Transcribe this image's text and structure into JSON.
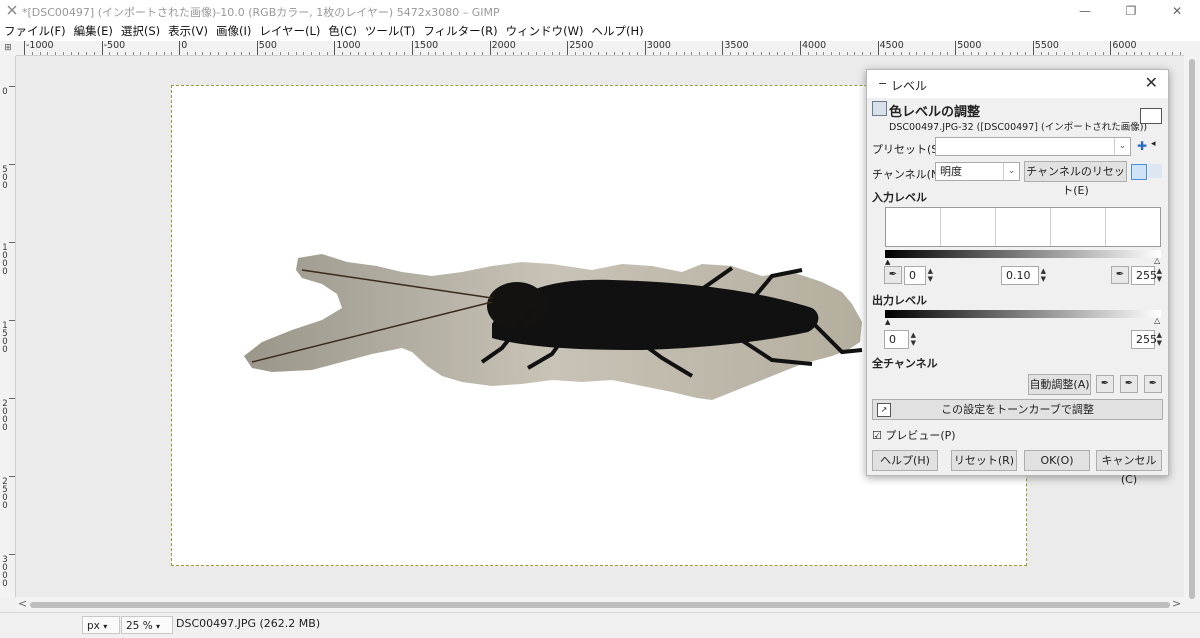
{
  "window": {
    "title": "*[DSC00497] (インポートされた画像)-10.0 (RGBカラー, 1枚のレイヤー) 5472x3080 – GIMP",
    "controls": [
      "minimize-icon",
      "restore-icon",
      "close-icon"
    ]
  },
  "menu": [
    "ファイル(F)",
    "編集(E)",
    "選択(S)",
    "表示(V)",
    "画像(I)",
    "レイヤー(L)",
    "色(C)",
    "ツール(T)",
    "フィルター(R)",
    "ウィンドウ(W)",
    "ヘルプ(H)"
  ],
  "ruler": {
    "h_labels": [
      "-1000",
      "-500",
      "0",
      "500",
      "1000",
      "1500",
      "2000",
      "2500",
      "3000",
      "3500",
      "4000",
      "4500",
      "5000",
      "5500",
      "6000"
    ],
    "v_labels": [
      "0",
      "500",
      "1000",
      "1500",
      "2000",
      "2500",
      "3000"
    ]
  },
  "status": {
    "unit": "px",
    "zoom": "25 %",
    "info": "DSC00497.JPG (262.2 MB)"
  },
  "dialog": {
    "title": "レベル",
    "heading": "色レベルの調整",
    "subheading": "DSC00497.JPG-32 ([DSC00497] (インポートされた画像))",
    "preset_label": "プリセット(S):",
    "preset_value": "",
    "channel_label": "チャンネル(N):",
    "channel_value": "明度",
    "reset_channel_button": "チャンネルのリセット(E)",
    "input_levels_label": "入力レベル",
    "input_low": "0",
    "input_gamma": "0.10",
    "input_high": "255",
    "output_levels_label": "出力レベル",
    "output_low": "0",
    "output_high": "255",
    "all_channels_label": "全チャンネル",
    "auto_button": "自動調整(A)",
    "curves_button": "この設定をトーンカーブで調整",
    "preview_label": "プレビュー(P)",
    "preview_checked": true,
    "help_button": "ヘルプ(H)",
    "reset_button": "リセット(R)",
    "ok_button": "OK(O)",
    "cancel_button": "キャンセル(C)"
  }
}
